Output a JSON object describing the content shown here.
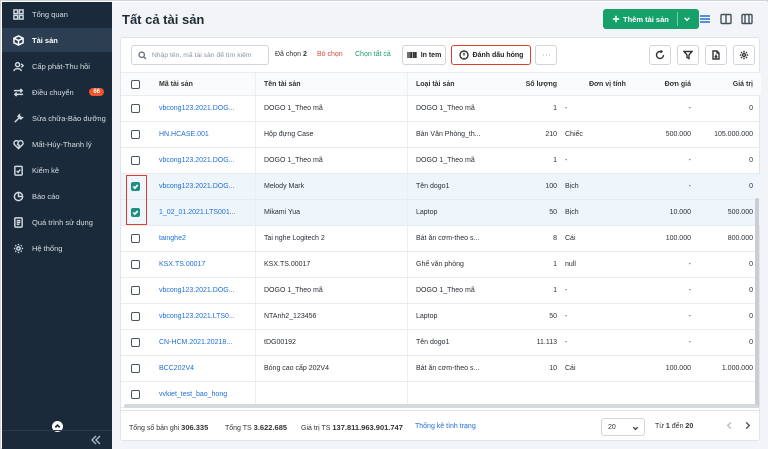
{
  "sidebar": {
    "items": [
      {
        "label": "Tổng quan",
        "icon": "dashboard-icon"
      },
      {
        "label": "Tài sản",
        "icon": "cube-icon",
        "active": true
      },
      {
        "label": "Cấp phát-Thu hồi",
        "icon": "user-transfer-icon"
      },
      {
        "label": "Điều chuyển",
        "icon": "swap-icon",
        "badge": "66"
      },
      {
        "label": "Sửa chữa-Bảo dưỡng",
        "icon": "wrench-icon"
      },
      {
        "label": "Mất-Hủy-Thanh lý",
        "icon": "broken-heart-icon"
      },
      {
        "label": "Kiểm kê",
        "icon": "clipboard-check-icon"
      },
      {
        "label": "Báo cáo",
        "icon": "pie-chart-icon"
      },
      {
        "label": "Quá trình sử dụng",
        "icon": "document-icon"
      },
      {
        "label": "Hệ thống",
        "icon": "gear-icon"
      }
    ]
  },
  "header": {
    "title": "Tất cả tài sản",
    "add_label": "Thêm tài sản"
  },
  "toolbar": {
    "search_placeholder": "Nhập tên, mã tài sản để tìm kiếm",
    "selected_prefix": "Đã chọn",
    "selected_count": "2",
    "unselect_label": "Bỏ chọn",
    "select_all_label": "Chọn tất cả",
    "print_label": "In tem",
    "mark_broken_label": "Đánh dấu hỏng"
  },
  "table": {
    "headers": {
      "code": "Mã tài sản",
      "name": "Tên tài sản",
      "type": "Loại tài sản",
      "qty": "Số lượng",
      "unit": "Đơn vị tính",
      "price": "Đơn giá",
      "value": "Giá trị"
    },
    "rows": [
      {
        "checked": false,
        "code": "vbcong123.2021.DOG...",
        "name": "DOGO 1_Theo mã",
        "type": "DOGO 1_Theo mã",
        "qty": "1",
        "unit": "-",
        "price": "-",
        "value": "0"
      },
      {
        "checked": false,
        "code": "HN.HCASE.001",
        "name": "Hộp đựng Case",
        "type": "Bàn Văn Phòng_th...",
        "qty": "210",
        "unit": "Chiếc",
        "price": "500.000",
        "value": "105.000.000"
      },
      {
        "checked": false,
        "code": "vbcong123.2021.DOG...",
        "name": "DOGO 1_Theo mã",
        "type": "DOGO 1_Theo mã",
        "qty": "1",
        "unit": "-",
        "price": "-",
        "value": "0"
      },
      {
        "checked": true,
        "code": "vbcong123.2021.DOG...",
        "name": "Melody Mark",
        "type": "Tên dogo1",
        "qty": "100",
        "unit": "Bịch",
        "price": "-",
        "value": "0"
      },
      {
        "checked": true,
        "code": "1_02_01.2021.LTS001...",
        "name": "Mikami Yua",
        "type": "Laptop",
        "qty": "50",
        "unit": "Bịch",
        "price": "10.000",
        "value": "500.000"
      },
      {
        "checked": false,
        "code": "tainghe2",
        "name": "Tai nghe Logitech 2",
        "type": "Bát ăn cơm-theo s...",
        "qty": "8",
        "unit": "Cái",
        "price": "100.000",
        "value": "800.000"
      },
      {
        "checked": false,
        "code": "KSX.TS.00017",
        "name": "KSX.TS.00017",
        "type": "Ghế văn phòng",
        "qty": "1",
        "unit": "null",
        "price": "-",
        "value": "0"
      },
      {
        "checked": false,
        "code": "vbcong123.2021.DOG...",
        "name": "DOGO 1_Theo mã",
        "type": "DOGO 1_Theo mã",
        "qty": "1",
        "unit": "-",
        "price": "-",
        "value": "0"
      },
      {
        "checked": false,
        "code": "vbcong123.2021.LTS0...",
        "name": "NTAnh2_123456",
        "type": "Laptop",
        "qty": "50",
        "unit": "-",
        "price": "-",
        "value": "0"
      },
      {
        "checked": false,
        "code": "CN-HCM.2021.20218...",
        "name": "tDG00192",
        "type": "Tên dogo1",
        "qty": "11.113",
        "unit": "-",
        "price": "-",
        "value": "0"
      },
      {
        "checked": false,
        "code": "BCC202V4",
        "name": "Bóng cao cấp 202V4",
        "type": "Bát ăn cơm-theo s...",
        "qty": "10",
        "unit": "Cái",
        "price": "100.000",
        "value": "1.000.000"
      },
      {
        "checked": false,
        "code": "vvkiet_test_bao_hong",
        "name": "",
        "type": "",
        "qty": "",
        "unit": "",
        "price": "",
        "value": ""
      }
    ]
  },
  "footer": {
    "total_records_label": "Tổng số bản ghi",
    "total_records": "306.335",
    "total_ts_label": "Tổng TS",
    "total_ts": "3.622.685",
    "total_value_label": "Giá trị TS",
    "total_value": "137.811.963.901.747",
    "stats_link": "Thống kê tình trạng",
    "page_size": "20",
    "range_from_label": "Từ",
    "range_from": "1",
    "range_to_label": "đến",
    "range_to": "20"
  },
  "colors": {
    "sidebar_bg": "#1b2a3a",
    "accent_green": "#16a06a",
    "link_blue": "#1e6fd6",
    "highlight_red": "#e23c2c",
    "badge_orange": "#f0552b"
  }
}
